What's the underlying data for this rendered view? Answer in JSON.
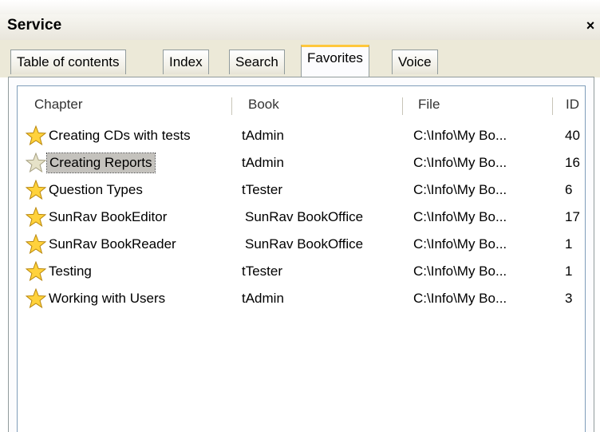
{
  "window": {
    "title": "Service",
    "close_label": "×"
  },
  "tabs": [
    {
      "label": "Table of contents",
      "active": false
    },
    {
      "label": "Index",
      "active": false
    },
    {
      "label": "Search",
      "active": false
    },
    {
      "label": "Favorites",
      "active": true
    },
    {
      "label": "Voice",
      "active": false
    }
  ],
  "favorites": {
    "columns": {
      "chapter": "Chapter",
      "book": "Book",
      "file": "File",
      "id": "ID"
    },
    "rows": [
      {
        "chapter": "Creating CDs with tests",
        "book": "tAdmin",
        "file": "C:\\Info\\My Bo...",
        "id": "40",
        "icon": "star-icon"
      },
      {
        "chapter": "Creating Reports",
        "book": "tAdmin",
        "file": "C:\\Info\\My Bo...",
        "id": "16",
        "icon": "star-icon",
        "selected": true
      },
      {
        "chapter": "Question Types",
        "book": "tTester",
        "file": "C:\\Info\\My Bo...",
        "id": "6",
        "icon": "star-icon"
      },
      {
        "chapter": "SunRav BookEditor",
        "book": "SunRav BookOffice",
        "file": "C:\\Info\\My Bo...",
        "id": "17",
        "icon": "star-icon"
      },
      {
        "chapter": "SunRav BookReader",
        "book": "SunRav BookOffice",
        "file": "C:\\Info\\My Bo...",
        "id": "1",
        "icon": "star-icon"
      },
      {
        "chapter": "Testing",
        "book": "tTester",
        "file": "C:\\Info\\My Bo...",
        "id": "1",
        "icon": "star-icon"
      },
      {
        "chapter": "Working with Users",
        "book": "tAdmin",
        "file": "C:\\Info\\My Bo...",
        "id": "3",
        "icon": "star-icon"
      }
    ]
  },
  "colors": {
    "active_tab_accent": "#ffc83c",
    "star_fill": "#ffd23c",
    "star_outline": "#b8860b",
    "selection": "#c4c2bd"
  }
}
